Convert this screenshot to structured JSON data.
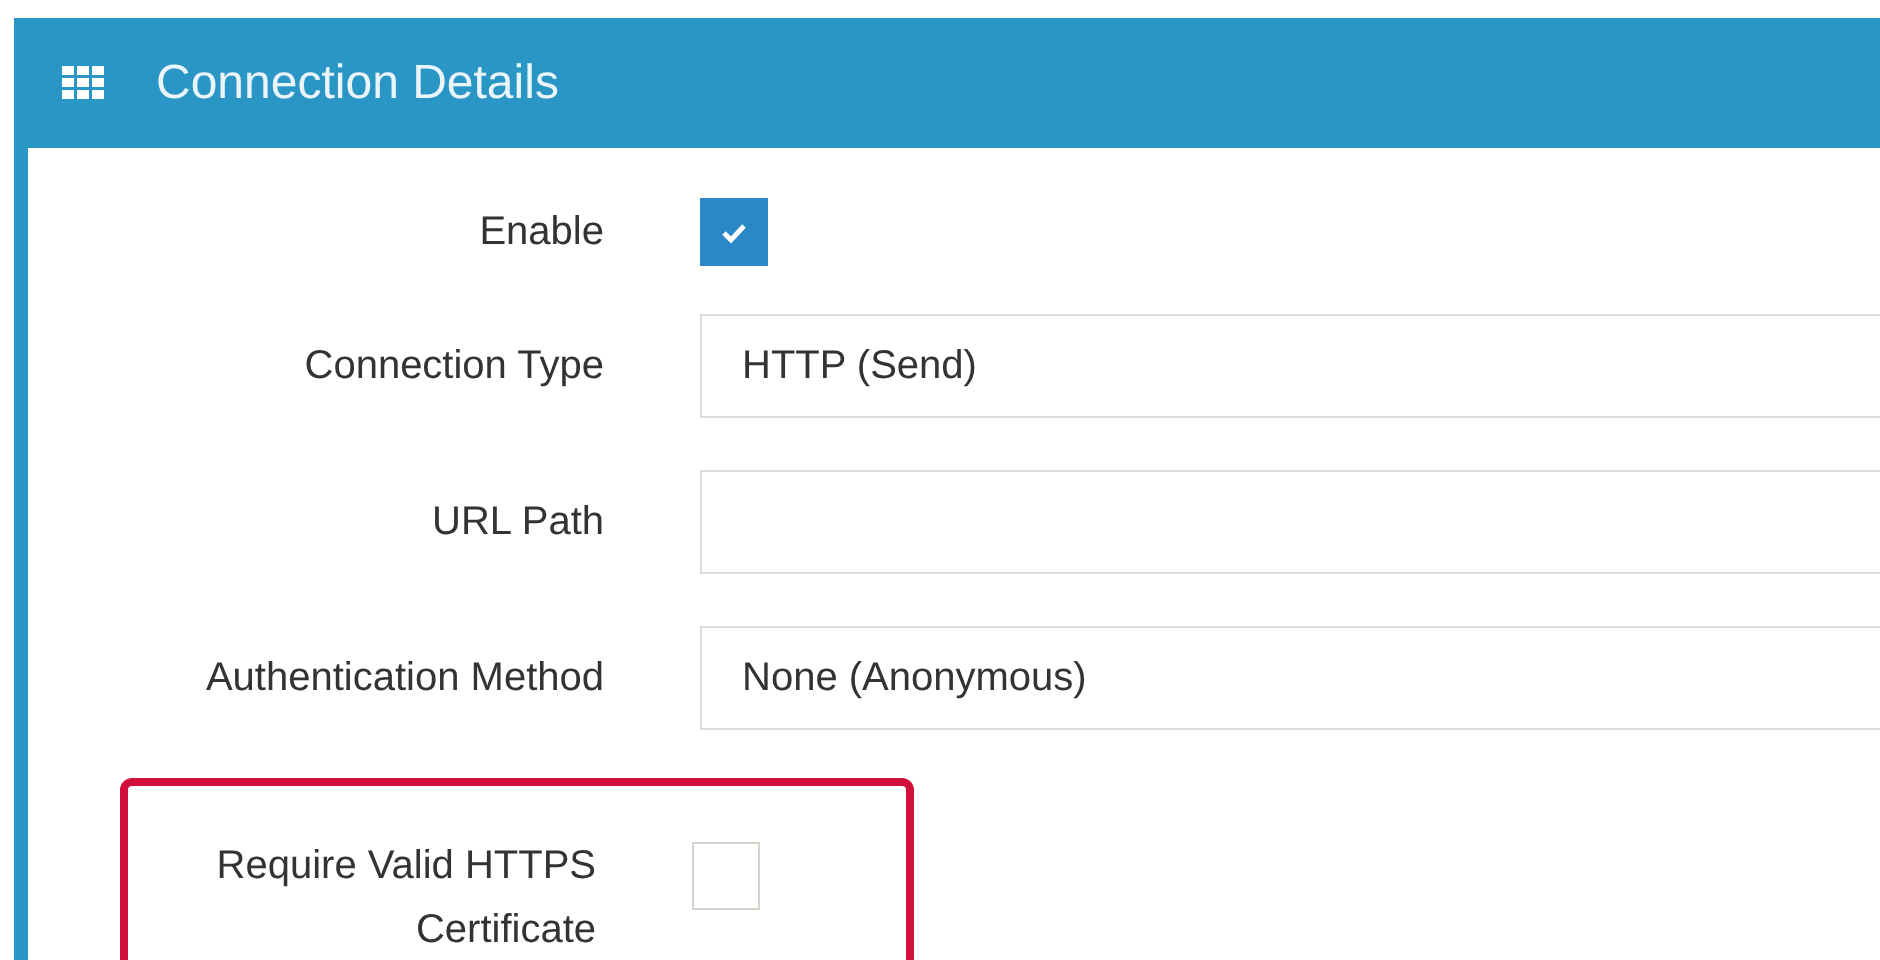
{
  "panel": {
    "title": "Connection Details"
  },
  "fields": [
    {
      "kind": "checkbox",
      "label": "Enable",
      "checked": true,
      "highlighted": false
    },
    {
      "kind": "text",
      "label": "Connection Type",
      "value": "HTTP (Send)",
      "highlighted": false
    },
    {
      "kind": "text",
      "label": "URL Path",
      "highlighted": false
    },
    {
      "kind": "text",
      "label": "Authentication Method",
      "value": "None (Anonymous)",
      "highlighted": false
    },
    {
      "kind": "checkbox",
      "label": "Require Valid HTTPS Certificate",
      "checked": false,
      "highlighted": true
    }
  ]
}
